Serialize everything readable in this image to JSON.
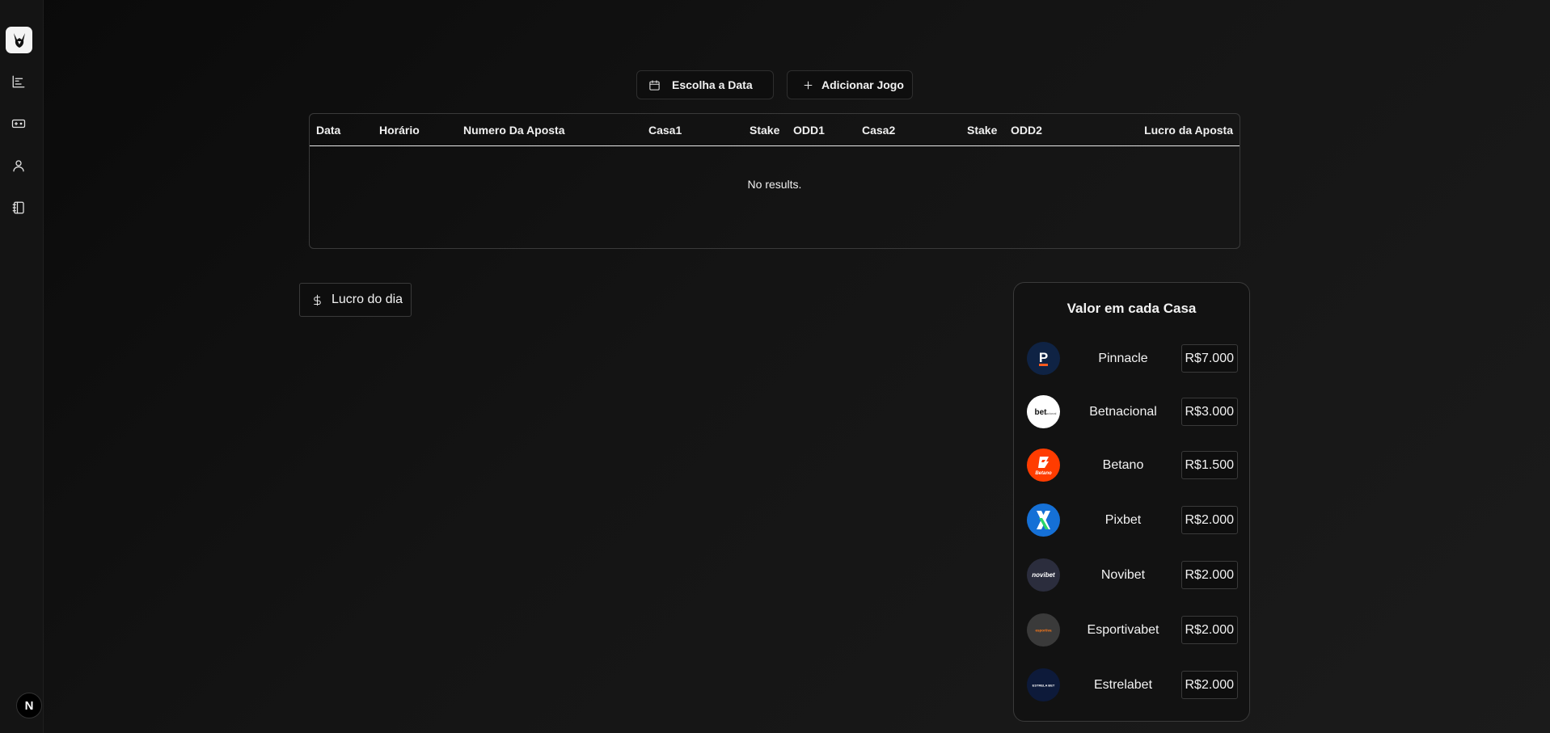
{
  "sidebar": {
    "logo_icon": "rabbit-logo-icon",
    "items": [
      {
        "name": "chart-icon",
        "label": ""
      },
      {
        "name": "ticket-icon",
        "label": ""
      },
      {
        "name": "user-icon",
        "label": ""
      },
      {
        "name": "notebook-icon",
        "label": ""
      }
    ],
    "badge_letter": "N"
  },
  "toolbar": {
    "date_label": "Escolha a Data",
    "add_label": "Adicionar Jogo"
  },
  "table": {
    "columns": [
      "Data",
      "Horário",
      "Numero Da Aposta",
      "Casa1",
      "Stake",
      "ODD1",
      "Casa2",
      "Stake",
      "ODD2",
      "Lucro da Aposta"
    ],
    "empty_text": "No results."
  },
  "lucro": {
    "label": "Lucro do dia"
  },
  "panel": {
    "title": "Valor em cada Casa",
    "casas": [
      {
        "name": "Pinnacle",
        "value": "R$7.000",
        "color": "#0f2344",
        "logo_text": "P",
        "accent": "#ff5a1f"
      },
      {
        "name": "Betnacional",
        "value": "R$3.000",
        "color": "#ffffff",
        "logo_text": "bet",
        "accent": "#111111"
      },
      {
        "name": "Betano",
        "value": "R$1.500",
        "color": "#ff3c00",
        "logo_text": "B",
        "accent": "#ffffff"
      },
      {
        "name": "Pixbet",
        "value": "R$2.000",
        "color": "#1570d6",
        "logo_text": "X",
        "accent": "#2bd66b"
      },
      {
        "name": "Novibet",
        "value": "R$2.000",
        "color": "#2b2d3d",
        "logo_text": "novibet",
        "accent": "#ffffff"
      },
      {
        "name": "Esportivabet",
        "value": "R$2.000",
        "color": "#3a3a3a",
        "logo_text": "esportiva",
        "accent": "#ff7a1a"
      },
      {
        "name": "Estrelabet",
        "value": "R$2.000",
        "color": "#0d1a3a",
        "logo_text": "ESTRELA BET",
        "accent": "#ffffff"
      }
    ]
  }
}
